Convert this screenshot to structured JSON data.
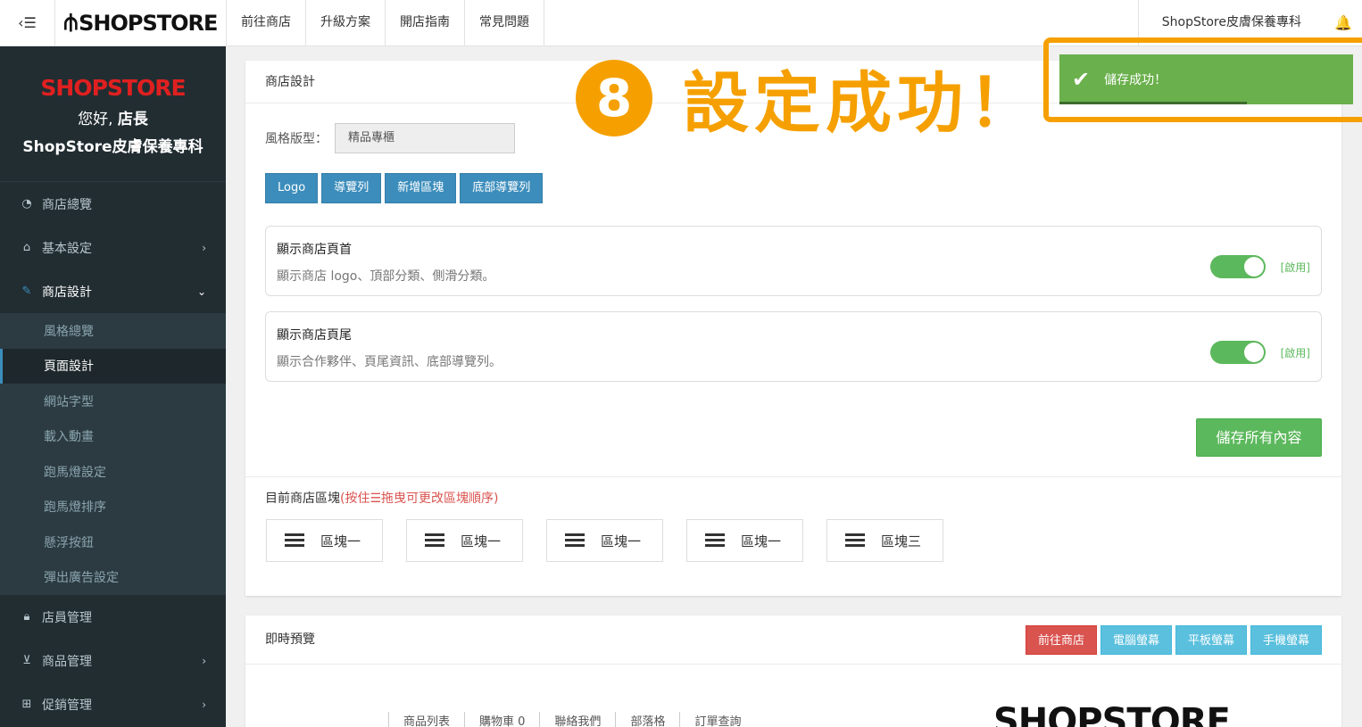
{
  "topbar": {
    "toggle_icon": "menu-icon",
    "brand": "SHOPSTORE",
    "nav": [
      "前往商店",
      "升級方案",
      "開店指南",
      "常見問題"
    ],
    "store_name": "ShopStore皮膚保養專科",
    "bell_icon": "bell-icon"
  },
  "sidebar": {
    "logo": "SHOPSTORE",
    "hello_prefix": "您好, ",
    "hello_name": "店長",
    "store_name": "ShopStore皮膚保養專科",
    "items": [
      {
        "label": "商店總覽",
        "icon": "dashboard-icon"
      },
      {
        "label": "基本設定",
        "icon": "bank-icon"
      },
      {
        "label": "商店設計",
        "icon": "wand-icon"
      },
      {
        "label": "店員管理",
        "icon": "lock-icon"
      },
      {
        "label": "商品管理",
        "icon": "cart-icon"
      },
      {
        "label": "促銷管理",
        "icon": "gift-icon"
      }
    ],
    "subitems": [
      "風格總覽",
      "頁面設計",
      "網站字型",
      "載入動畫",
      "跑馬燈設定",
      "跑馬燈排序",
      "懸浮按鈕",
      "彈出廣告設定"
    ]
  },
  "design": {
    "title": "商店設計",
    "style_label": "風格版型：",
    "style_value": "精品專櫃",
    "buttons": [
      "Logo",
      "導覽列",
      "新增區塊",
      "底部導覽列"
    ],
    "header_box": {
      "title": "顯示商店頁首",
      "desc": "顯示商店 logo、頂部分類、側滑分類。",
      "status": "[啟用]"
    },
    "footer_box": {
      "title": "顯示商店頁尾",
      "desc": "顯示合作夥伴、頁尾資訊、底部導覽列。",
      "status": "[啟用]"
    },
    "save_label": "儲存所有內容",
    "blocks_title": "目前商店區塊",
    "blocks_hint": "(按住☰拖曳可更改區塊順序)",
    "blocks": [
      "區塊一",
      "區塊一",
      "區塊一",
      "區塊一",
      "區塊三"
    ]
  },
  "preview": {
    "title": "即時預覽",
    "buttons": [
      "前往商店",
      "電腦螢幕",
      "平板螢幕",
      "手機螢幕"
    ],
    "nav": [
      "商品列表",
      "購物車 0",
      "聯絡我們",
      "部落格",
      "訂單查詢"
    ],
    "logo": "SHOPSTORE"
  },
  "annotation": {
    "number": "8",
    "text": "設定成功！"
  },
  "toast": {
    "message": "儲存成功！",
    "icon": "check-icon"
  },
  "colors": {
    "sidebar_bg": "#222d32",
    "primary": "#3c8dbc",
    "success": "#5cb85c",
    "danger": "#d9534f",
    "info": "#5bc0de",
    "annotation": "#f5a000"
  }
}
